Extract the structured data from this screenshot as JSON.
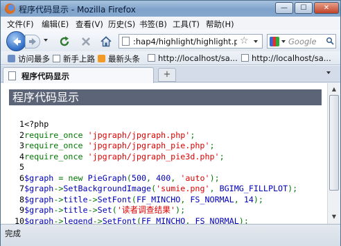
{
  "window": {
    "title": "程序代码显示 - Mozilla Firefox"
  },
  "menu": [
    "文件(F)",
    "编辑(E)",
    "查看(V)",
    "历史(S)",
    "书签(B)",
    "工具(T)",
    "帮助(H)"
  ],
  "nav": {
    "url": ":hap4/highlight/highlight.php",
    "search_placeholder": "Google"
  },
  "bookmarks": [
    "访问最多",
    "新手上路",
    "最新头条",
    "http://localhost/sa...",
    "http://localhost/sa..."
  ],
  "tab": {
    "label": "程序代码显示"
  },
  "page": {
    "header": "程序代码显示"
  },
  "code_lines": [
    {
      "n": "1",
      "parts": [
        {
          "t": "<?php",
          "c": "php"
        }
      ]
    },
    {
      "n": "2",
      "parts": [
        {
          "t": "require_once ",
          "c": "kw"
        },
        {
          "t": "'jpgraph/jpgraph.php'",
          "c": "str"
        },
        {
          "t": ";",
          "c": "kw"
        }
      ]
    },
    {
      "n": "3",
      "parts": [
        {
          "t": "require_once ",
          "c": "kw"
        },
        {
          "t": "'jpgraph/jpgraph_pie.php'",
          "c": "str"
        },
        {
          "t": ";",
          "c": "kw"
        }
      ]
    },
    {
      "n": "4",
      "parts": [
        {
          "t": "require_once ",
          "c": "kw"
        },
        {
          "t": "'jpgraph/jpgraph_pie3d.php'",
          "c": "str"
        },
        {
          "t": ";",
          "c": "kw"
        }
      ]
    },
    {
      "n": "5",
      "parts": []
    },
    {
      "n": "6",
      "parts": [
        {
          "t": "$graph",
          "c": "var"
        },
        {
          "t": " = new ",
          "c": "kw"
        },
        {
          "t": "PieGraph",
          "c": "var"
        },
        {
          "t": "(",
          "c": "kw"
        },
        {
          "t": "500",
          "c": "var"
        },
        {
          "t": ", ",
          "c": "kw"
        },
        {
          "t": "400",
          "c": "var"
        },
        {
          "t": ", ",
          "c": "kw"
        },
        {
          "t": "'auto'",
          "c": "str"
        },
        {
          "t": ");",
          "c": "kw"
        }
      ]
    },
    {
      "n": "7",
      "parts": [
        {
          "t": "$graph",
          "c": "var"
        },
        {
          "t": "->",
          "c": "kw"
        },
        {
          "t": "SetBackgroundImage",
          "c": "var"
        },
        {
          "t": "(",
          "c": "kw"
        },
        {
          "t": "'sumie.png'",
          "c": "str"
        },
        {
          "t": ", ",
          "c": "kw"
        },
        {
          "t": "BGIMG_FILLPLOT",
          "c": "var"
        },
        {
          "t": ");",
          "c": "kw"
        }
      ]
    },
    {
      "n": "8",
      "parts": [
        {
          "t": "$graph",
          "c": "var"
        },
        {
          "t": "->",
          "c": "kw"
        },
        {
          "t": "title",
          "c": "var"
        },
        {
          "t": "->",
          "c": "kw"
        },
        {
          "t": "SetFont",
          "c": "var"
        },
        {
          "t": "(",
          "c": "kw"
        },
        {
          "t": "FF_MINCHO",
          "c": "var"
        },
        {
          "t": ", ",
          "c": "kw"
        },
        {
          "t": "FS_NORMAL",
          "c": "var"
        },
        {
          "t": ", ",
          "c": "kw"
        },
        {
          "t": "14",
          "c": "var"
        },
        {
          "t": ");",
          "c": "kw"
        }
      ]
    },
    {
      "n": "9",
      "parts": [
        {
          "t": "$graph",
          "c": "var"
        },
        {
          "t": "->",
          "c": "kw"
        },
        {
          "t": "title",
          "c": "var"
        },
        {
          "t": "->",
          "c": "kw"
        },
        {
          "t": "Set",
          "c": "var"
        },
        {
          "t": "(",
          "c": "kw"
        },
        {
          "t": "'读者调查结果'",
          "c": "str"
        },
        {
          "t": ");",
          "c": "kw"
        }
      ]
    },
    {
      "n": "10",
      "parts": [
        {
          "t": "$graph",
          "c": "var"
        },
        {
          "t": "->",
          "c": "kw"
        },
        {
          "t": "legend",
          "c": "var"
        },
        {
          "t": "->",
          "c": "kw"
        },
        {
          "t": "SetFont",
          "c": "var"
        },
        {
          "t": "(",
          "c": "kw"
        },
        {
          "t": "FF_MINCHO",
          "c": "var"
        },
        {
          "t": ", ",
          "c": "kw"
        },
        {
          "t": "FS_NORMAL",
          "c": "var"
        },
        {
          "t": ");",
          "c": "kw"
        }
      ]
    }
  ],
  "status": {
    "text": "完成"
  },
  "colors": {
    "header_bg": "#5c6478",
    "kw": "#007700",
    "str": "#dd0000",
    "var": "#0000bb"
  }
}
